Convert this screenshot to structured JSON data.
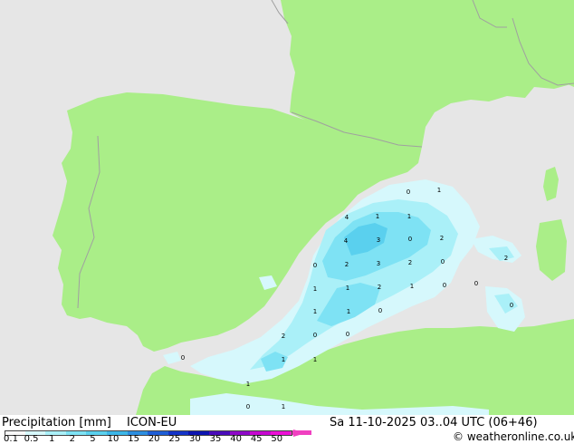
{
  "map": {
    "land_color": "#aaee88",
    "sea_color": "#e6e6e6",
    "border_color": "#a0a0a0",
    "precip_values": [
      {
        "text": "0"
      },
      {
        "text": "1"
      },
      {
        "text": "4"
      },
      {
        "text": "1"
      },
      {
        "text": "1"
      },
      {
        "text": "4"
      },
      {
        "text": "3"
      },
      {
        "text": "0"
      },
      {
        "text": "2"
      },
      {
        "text": "0"
      },
      {
        "text": "2"
      },
      {
        "text": "3"
      },
      {
        "text": "2"
      },
      {
        "text": "0"
      },
      {
        "text": "2"
      },
      {
        "text": "0"
      },
      {
        "text": "1"
      },
      {
        "text": "1"
      },
      {
        "text": "2"
      },
      {
        "text": "1"
      },
      {
        "text": "0"
      },
      {
        "text": "0"
      },
      {
        "text": "1"
      },
      {
        "text": "1"
      },
      {
        "text": "0"
      },
      {
        "text": "2"
      },
      {
        "text": "0"
      },
      {
        "text": "0"
      },
      {
        "text": "0"
      },
      {
        "text": "1"
      },
      {
        "text": "1"
      },
      {
        "text": "1"
      },
      {
        "text": "0"
      },
      {
        "text": "1"
      }
    ]
  },
  "footer": {
    "title": "Precipitation [mm]",
    "model": "ICON-EU",
    "datetime": "Sa 11-10-2025 03..04 UTC (06+46)",
    "copyright": "© weatheronline.co.uk",
    "legend": {
      "colors": [
        "#f8f8f8",
        "#d6f8fc",
        "#aaf0f8",
        "#7ee2f4",
        "#5ad0ee",
        "#3cb6e8",
        "#2c8ee0",
        "#1e5ed6",
        "#1434c8",
        "#0c14b0",
        "#4a0cba",
        "#8e08c8",
        "#c608d0",
        "#ec10d6",
        "#f040c0"
      ],
      "ticks": [
        "0.1",
        "0.5",
        "1",
        "2",
        "5",
        "10",
        "15",
        "20",
        "25",
        "30",
        "35",
        "40",
        "45",
        "50"
      ]
    }
  }
}
